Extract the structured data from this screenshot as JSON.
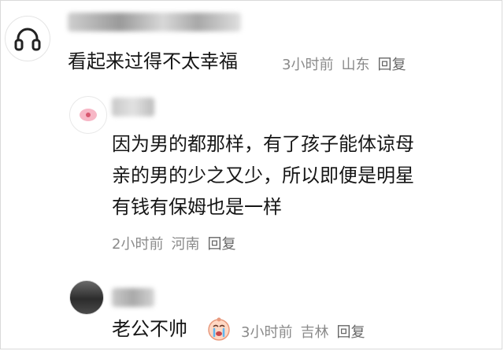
{
  "comments": [
    {
      "text": "看起来过得不太幸福",
      "time": "3小时前",
      "location": "山东",
      "reply": "回复",
      "avatar_icon": "headphones-icon"
    },
    {
      "lines": [
        "因为男的都那样，有了孩子能体谅母",
        "亲的男的少之又少，所以即便是明星",
        "有钱有保姆也是一样"
      ],
      "time": "2小时前",
      "location": "河南",
      "reply": "回复",
      "avatar_icon": "record-disc-icon"
    },
    {
      "text": "老公不帅",
      "emoji_icon": "crying-face-emoji-icon",
      "time": "3小时前",
      "location": "吉林",
      "reply": "回复",
      "avatar_icon": "dark-photo-avatar"
    }
  ]
}
